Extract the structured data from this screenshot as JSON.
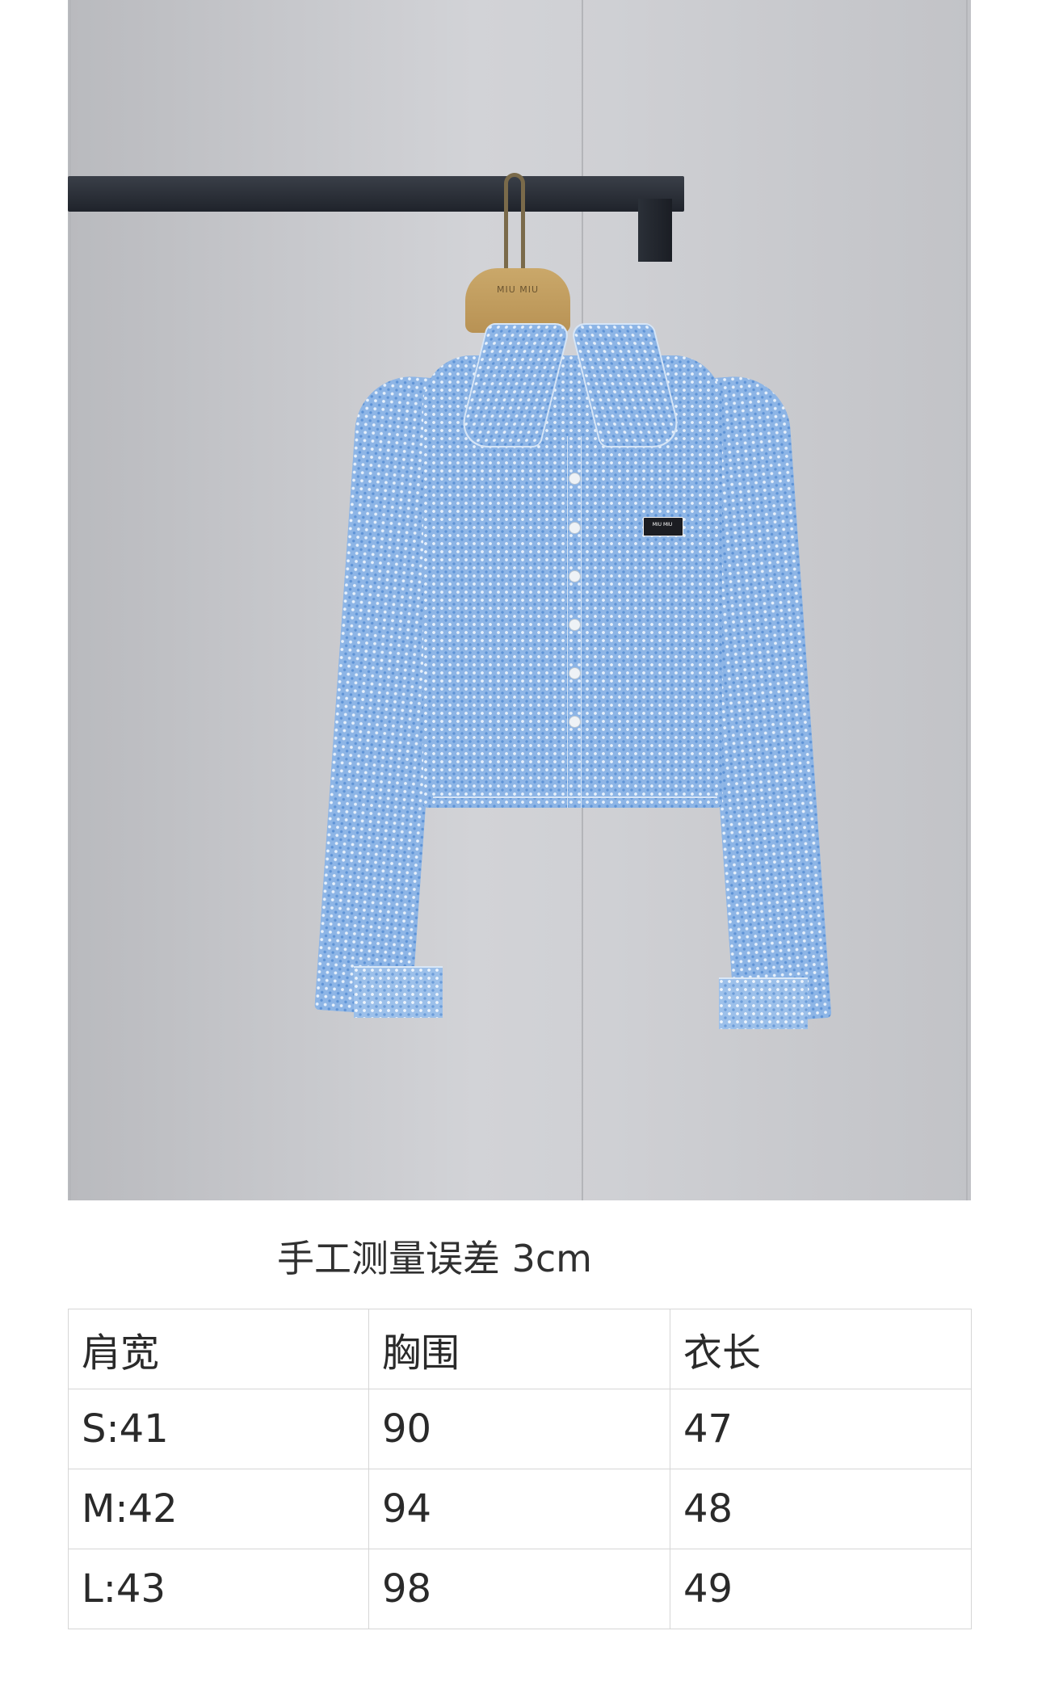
{
  "photo": {
    "hanger_brand": "MIU MIU",
    "label_patch": "MIU MIU"
  },
  "caption": "手工测量误差 3cm",
  "size_table": {
    "headers": [
      "肩宽",
      "胸围",
      "衣长"
    ],
    "rows": [
      [
        "S:41",
        "90",
        "47"
      ],
      [
        "M:42",
        "94",
        "48"
      ],
      [
        "L:43",
        "98",
        "49"
      ]
    ]
  }
}
